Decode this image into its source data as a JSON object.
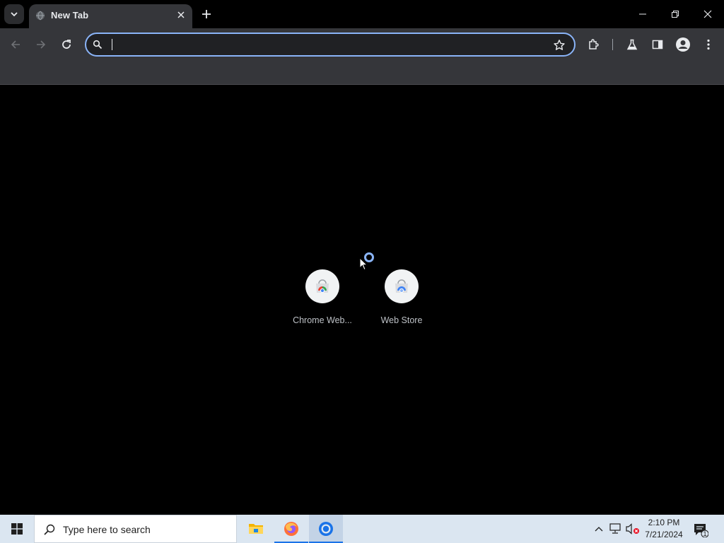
{
  "browser": {
    "tab": {
      "title": "New Tab",
      "favicon": "globe-icon",
      "close_icon": "close-icon"
    },
    "tab_search_icon": "chevron-down-icon",
    "new_tab_icon": "plus-icon",
    "window_controls": [
      "minimize-icon",
      "restore-icon",
      "close-icon"
    ]
  },
  "toolbar": {
    "back_icon": "back-arrow-icon",
    "forward_icon": "forward-arrow-icon",
    "reload_icon": "reload-icon",
    "omnibox": {
      "value": "",
      "placeholder": "",
      "search_icon": "search-icon",
      "bookmark_icon": "star-icon"
    },
    "right_icons": [
      "extensions-icon",
      "labs-flask-icon",
      "side-panel-icon",
      "profile-avatar-icon",
      "more-menu-icon"
    ]
  },
  "new_tab_page": {
    "shortcuts": [
      {
        "label": "Chrome Web...",
        "icon": "chrome-web-store-icon"
      },
      {
        "label": "Web Store",
        "icon": "web-store-icon"
      }
    ],
    "loading": true
  },
  "taskbar": {
    "start_icon": "windows-logo-icon",
    "search_placeholder": "Type here to search",
    "apps": [
      {
        "name": "File Explorer",
        "icon": "folder-icon",
        "running": false
      },
      {
        "name": "Firefox",
        "icon": "firefox-icon",
        "running": true
      },
      {
        "name": "Chrome",
        "icon": "chrome-icon",
        "running": true,
        "active": true
      }
    ],
    "tray": [
      "chevron-up-icon",
      "network-icon",
      "volume-muted-icon"
    ],
    "clock": {
      "time": "2:10 PM",
      "date": "7/21/2024"
    },
    "notifications": {
      "count": "1",
      "icon": "action-center-icon"
    }
  },
  "colors": {
    "accent": "#8ab4f8",
    "toolbar": "#35363a",
    "background": "#000000",
    "taskbar": "#dbe6f1"
  }
}
